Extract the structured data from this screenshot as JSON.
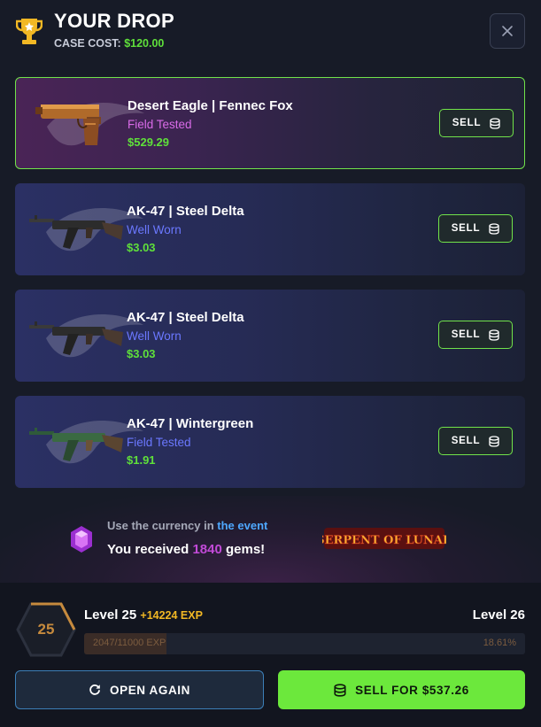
{
  "header": {
    "title": "YOUR DROP",
    "case_cost_label": "CASE COST:",
    "case_cost_value": "$120.00",
    "close_icon": "close-icon"
  },
  "items": [
    {
      "name": "Desert Eagle | Fennec Fox",
      "wear": "Field Tested",
      "wear_color": "#d96be8",
      "price": "$529.29",
      "sell_label": "SELL",
      "rarity": "gold"
    },
    {
      "name": "AK-47 | Steel Delta",
      "wear": "Well Worn",
      "wear_color": "#6b78ff",
      "price": "$3.03",
      "sell_label": "SELL",
      "rarity": "blue"
    },
    {
      "name": "AK-47 | Steel Delta",
      "wear": "Well Worn",
      "wear_color": "#6b78ff",
      "price": "$3.03",
      "sell_label": "SELL",
      "rarity": "blue"
    },
    {
      "name": "AK-47 | Wintergreen",
      "wear": "Field Tested",
      "wear_color": "#6b78ff",
      "price": "$1.91",
      "sell_label": "SELL",
      "rarity": "blue"
    }
  ],
  "event": {
    "line1_prefix": "Use the currency in",
    "line1_link": "the event",
    "line2_prefix": "You received",
    "gems_count": "1840",
    "line2_suffix": "gems!",
    "logo_text": "SERPENT OF LUNAR"
  },
  "level": {
    "current_label": "Level 25",
    "exp_gain": "+14224 EXP",
    "next_label": "Level 26",
    "badge": "25",
    "progress_text": "2047/11000 EXP",
    "progress_pct": "18.61%",
    "progress_fraction": 0.1861
  },
  "actions": {
    "open_again": "OPEN AGAIN",
    "sell_all": "SELL FOR $537.26"
  },
  "colors": {
    "accent_green": "#6ce83c",
    "price_green": "#5fe03a",
    "gold_border": "#71e34a",
    "link_blue": "#4ea8ff",
    "gem_purple": "#c24ad8"
  }
}
